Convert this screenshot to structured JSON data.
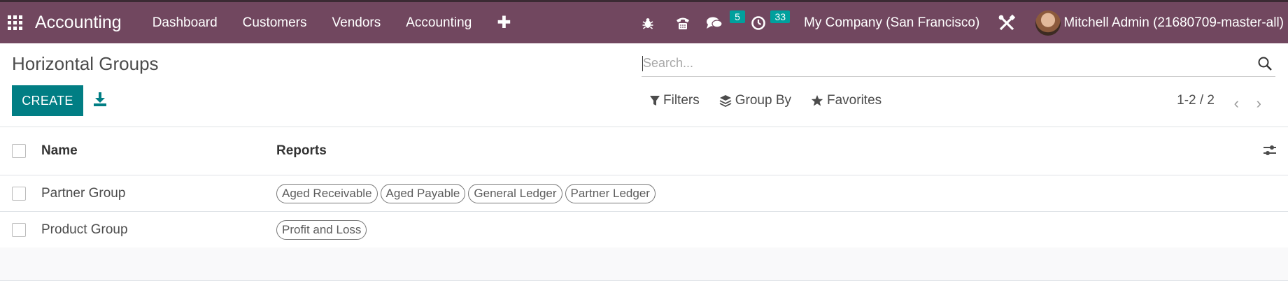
{
  "navbar": {
    "app_name": "Accounting",
    "menu": [
      "Dashboard",
      "Customers",
      "Vendors",
      "Accounting"
    ],
    "messages_count": "5",
    "activities_count": "33",
    "company": "My Company (San Francisco)",
    "user": "Mitchell Admin (21680709-master-all)",
    "color": "#71475f"
  },
  "control_panel": {
    "title": "Horizontal Groups",
    "create_label": "CREATE",
    "search_placeholder": "Search...",
    "filters_label": "Filters",
    "group_by_label": "Group By",
    "favorites_label": "Favorites",
    "pager": "1-2 / 2",
    "accent": "#017e84"
  },
  "table": {
    "headers": {
      "name": "Name",
      "reports": "Reports"
    },
    "rows": [
      {
        "name": "Partner Group",
        "reports": [
          "Aged Receivable",
          "Aged Payable",
          "General Ledger",
          "Partner Ledger"
        ]
      },
      {
        "name": "Product Group",
        "reports": [
          "Profit and Loss"
        ]
      }
    ]
  }
}
